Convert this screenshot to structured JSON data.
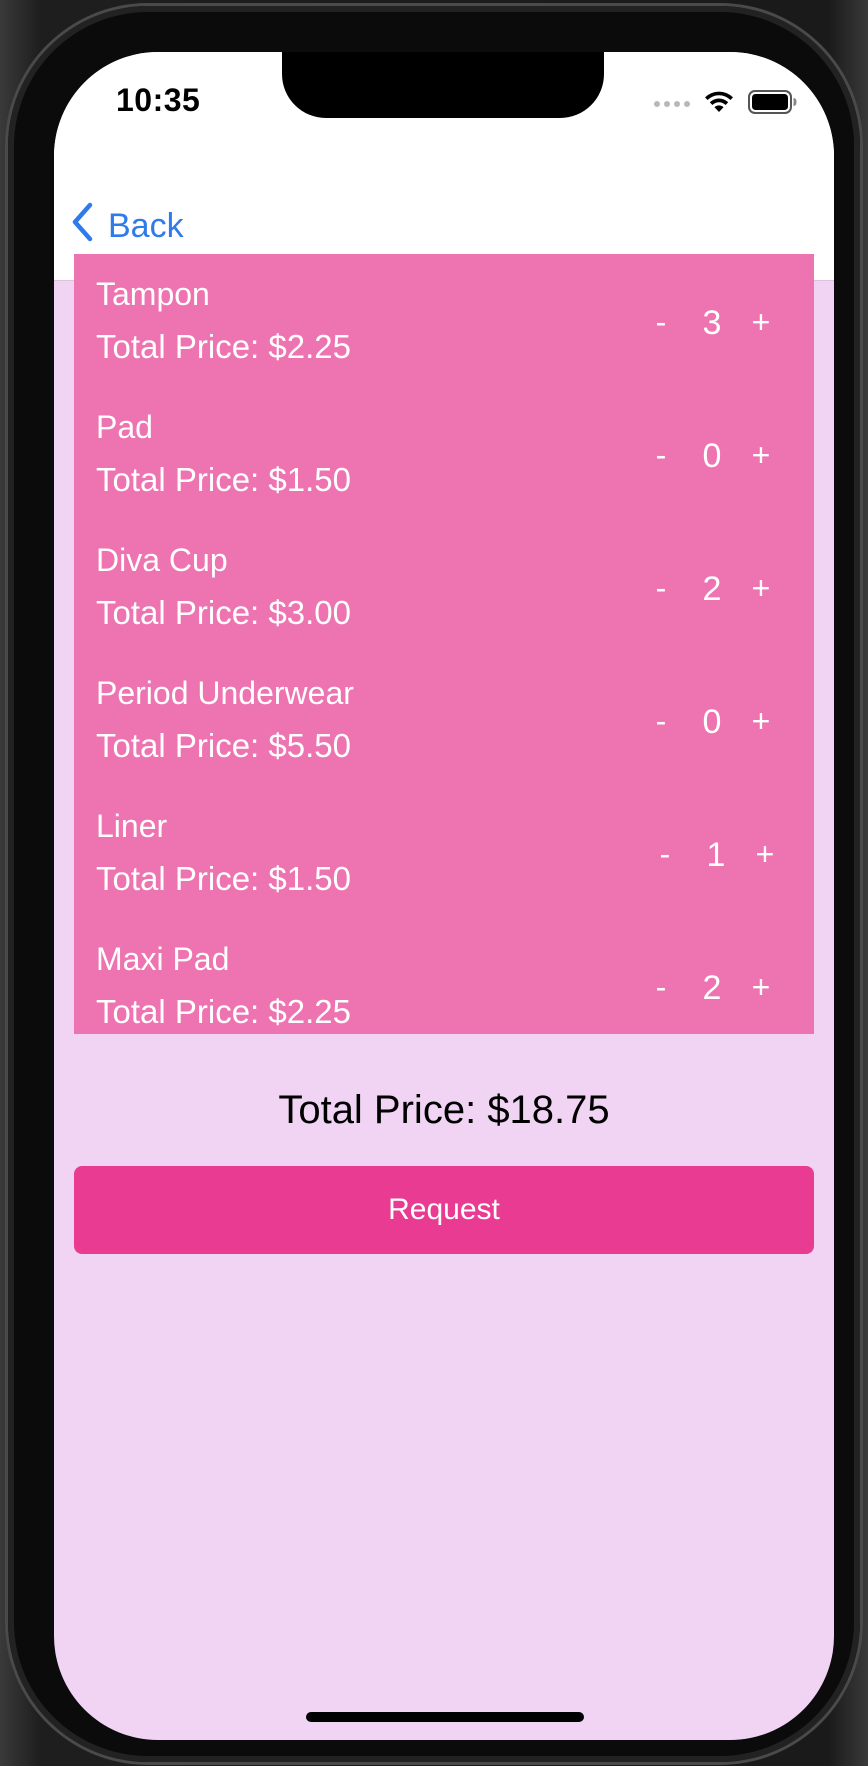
{
  "status_bar": {
    "time": "10:35",
    "icons": [
      "cellular-signal-icon",
      "wifi-icon",
      "battery-icon"
    ]
  },
  "nav": {
    "back_label": "Back",
    "back_icon": "chevron-left-icon"
  },
  "items": [
    {
      "name": "Tampon",
      "price_label": "Total Price:",
      "price": "$2.25",
      "quantity": "3",
      "minus": "-",
      "plus": "+"
    },
    {
      "name": "Pad",
      "price_label": "Total Price:",
      "price": "$1.50",
      "quantity": "0",
      "minus": "-",
      "plus": "+"
    },
    {
      "name": "Diva Cup",
      "price_label": "Total Price:",
      "price": "$3.00",
      "quantity": "2",
      "minus": "-",
      "plus": "+"
    },
    {
      "name": "Period Underwear",
      "price_label": "Total Price:",
      "price": "$5.50",
      "quantity": "0",
      "minus": "-",
      "plus": "+"
    },
    {
      "name": "Liner",
      "price_label": "Total Price:",
      "price": "$1.50",
      "quantity": "1",
      "minus": "-",
      "plus": "+"
    },
    {
      "name": "Maxi Pad",
      "price_label": "Total Price:",
      "price": "$2.25",
      "quantity": "2",
      "minus": "-",
      "plus": "+"
    }
  ],
  "summary": {
    "total_label": "Total Price:",
    "total_value": "$18.75"
  },
  "request_button": {
    "label": "Request"
  },
  "colors": {
    "background": "#f1d4f4",
    "list_panel": "#ed74b0",
    "request_button": "#ea3b92",
    "link_blue": "#2f7bea"
  }
}
